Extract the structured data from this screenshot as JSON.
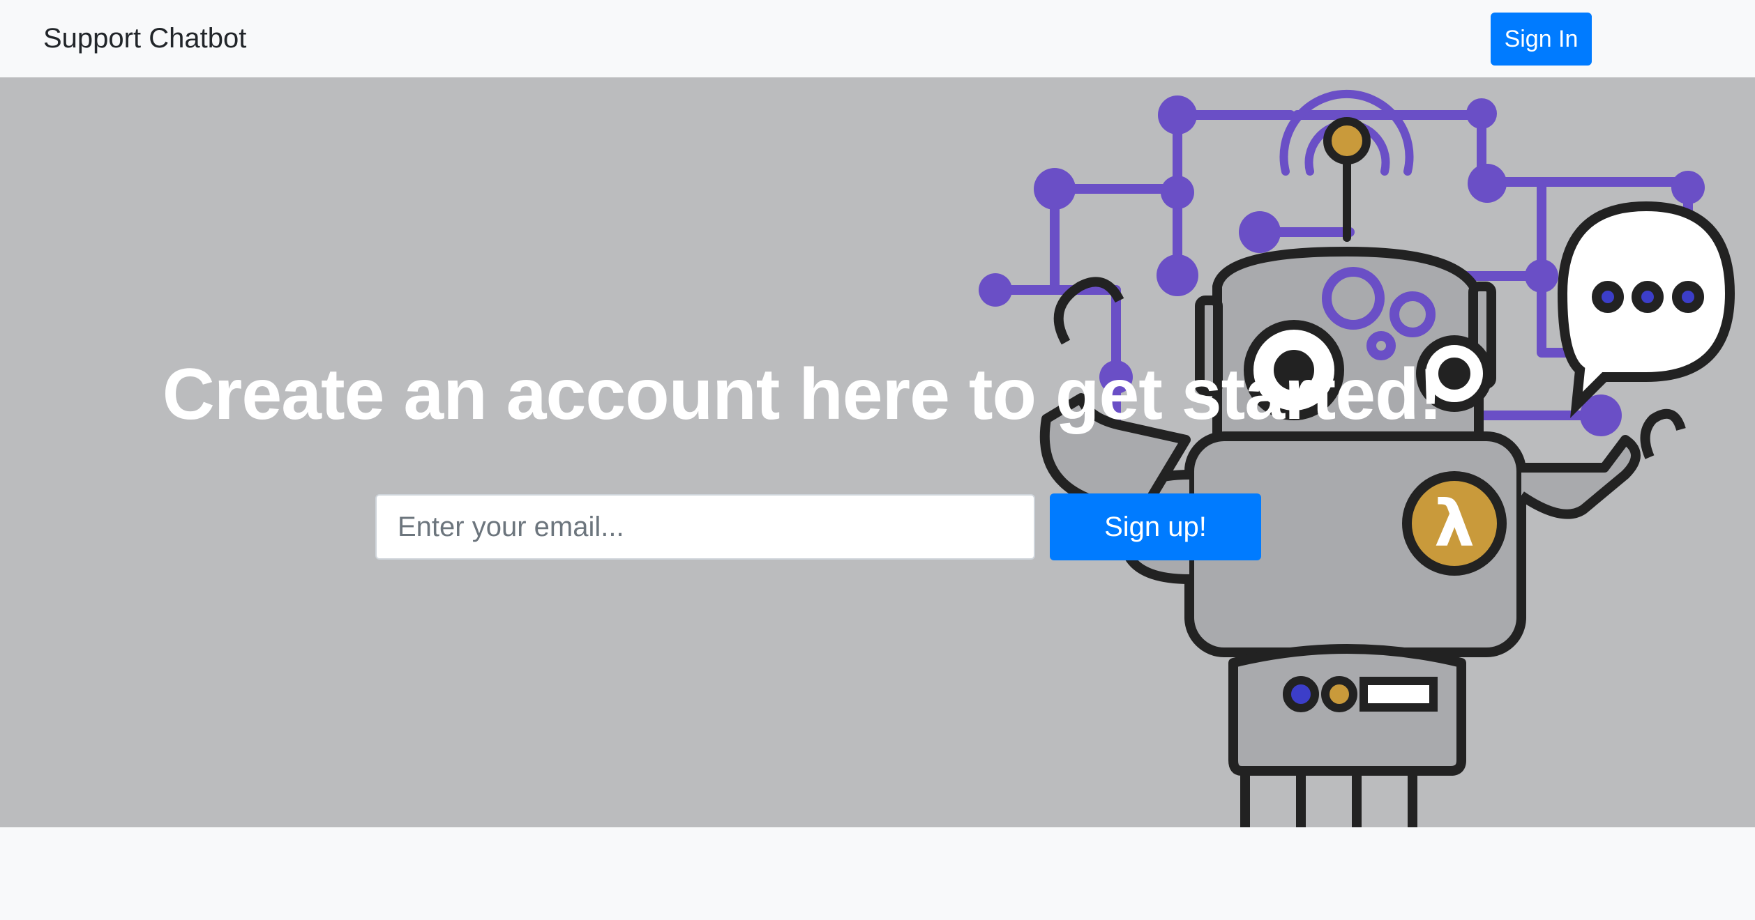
{
  "navbar": {
    "brand": "Support Chatbot",
    "sign_in_label": "Sign In"
  },
  "hero": {
    "headline": "Create an account here to get started!",
    "email_placeholder": "Enter your email...",
    "email_value": "",
    "sign_up_label": "Sign up!",
    "illustration": "robot-illustration",
    "lambda_symbol": "λ"
  },
  "colors": {
    "accent": "#007bff",
    "hero_bg": "#bbbcbe",
    "page_bg": "#f8f9fa",
    "circuit": "#6a4fc6",
    "gold": "#c99a3b",
    "robot_body": "#a9aaad",
    "outline": "#222222"
  }
}
